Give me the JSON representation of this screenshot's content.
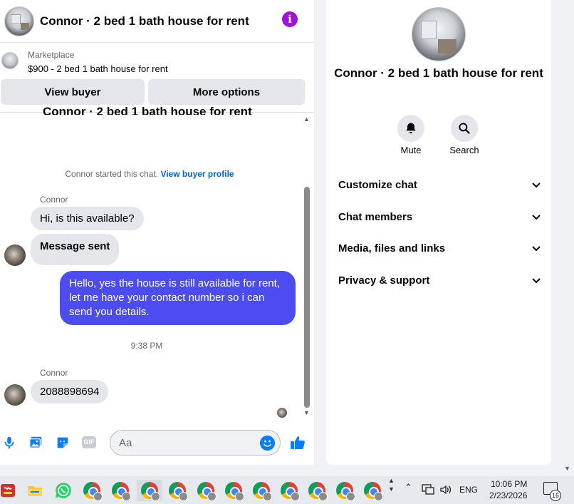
{
  "chat": {
    "header_title": "Connor · 2 bed 1 bath house for rent",
    "info_icon": "i",
    "marketplace": {
      "label": "Marketplace",
      "listing": "$900 - 2 bed 1 bath house for rent",
      "view_buyer_label": "View buyer",
      "more_options_label": "More options"
    },
    "cut_title": "Connor · 2 bed 1 bath house for rent",
    "started_text": "Connor started this chat.",
    "view_buyer_profile_link": "View buyer profile",
    "messages": [
      {
        "sender": "Connor",
        "text": "Hi, is this available?"
      },
      {
        "text": "Message sent"
      },
      {
        "text": "Hello, yes the house is still available for rent, let me have your contact number so i can send you details."
      },
      {
        "sender": "Connor",
        "text": "2088898694"
      }
    ],
    "timestamp": "9:38 PM",
    "composer_placeholder": "Aa",
    "gif_label": "GIF"
  },
  "info_panel": {
    "title": "Connor · 2 bed 1 bath house for rent",
    "mute_label": "Mute",
    "search_label": "Search",
    "sections": [
      "Customize chat",
      "Chat members",
      "Media, files and links",
      "Privacy & support"
    ]
  },
  "taskbar": {
    "language": "ENG",
    "time": "10:06 PM",
    "date": "2/23/2026",
    "notification_count": "16",
    "chrome_profile_count": 11
  },
  "colors": {
    "accent": "#0a7cff",
    "outgoing_bubble": "#4c4cf0",
    "info_button": "#9f12d9",
    "incoming_bubble": "#e4e6eb"
  }
}
